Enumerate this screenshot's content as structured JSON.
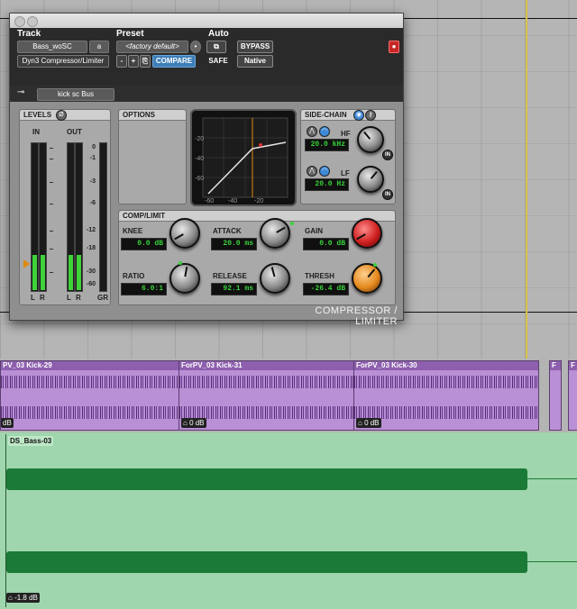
{
  "plugin": {
    "header": {
      "track_label": "Track",
      "track_name": "Bass_woSC",
      "track_variant": "a",
      "plugin_name": "Dyn3 Compressor/Limiter",
      "preset_label": "Preset",
      "preset_value": "<factory default>",
      "minus": "-",
      "plus": "+",
      "compare": "COMPARE",
      "auto_label": "Auto",
      "bypass": "BYPASS",
      "safe": "SAFE",
      "native": "Native"
    },
    "sidechain_key": "kick sc Bus",
    "levels": {
      "title": "LEVELS",
      "in_label": "IN",
      "out_label": "OUT",
      "scale": [
        "0",
        "-1",
        "-3",
        "-6",
        "-12",
        "-18",
        "-30",
        "-60"
      ],
      "l_label": "L",
      "r_label": "R",
      "gr_label": "GR",
      "in_level": 0.24,
      "out_level": 0.24
    },
    "options_title": "OPTIONS",
    "graph": {
      "y_ticks": [
        "-20",
        "-40",
        "-60"
      ],
      "x_ticks": [
        "-60",
        "-40",
        "-20"
      ]
    },
    "side_chain": {
      "title": "SIDE-CHAIN",
      "hf_label": "HF",
      "hf_value": "20.0 kHz",
      "lf_label": "LF",
      "lf_value": "20.0 Hz",
      "in_label": "IN"
    },
    "comp": {
      "title": "COMP/LIMIT",
      "knee_label": "KNEE",
      "knee_value": "0.0 dB",
      "attack_label": "ATTACK",
      "attack_value": "20.0 ms",
      "gain_label": "GAIN",
      "gain_value": "0.0 dB",
      "ratio_label": "RATIO",
      "ratio_value": "6.0:1",
      "release_label": "RELEASE",
      "release_value": "92.1 ms",
      "thresh_label": "THRESH",
      "thresh_value": "-26.4 dB"
    },
    "brand": "COMPRESSOR / LIMITER"
  },
  "tracks": {
    "kick_clips": [
      {
        "name": "PV_03 Kick-29",
        "gain": "dB"
      },
      {
        "name": "ForPV_03 Kick-31",
        "gain": "0 dB"
      },
      {
        "name": "ForPV_03 Kick-30",
        "gain": "0 dB"
      },
      {
        "name": "F",
        "gain": ""
      },
      {
        "name": "F",
        "gain": ""
      }
    ],
    "bass_clip": {
      "name": "DS_Bass-03",
      "gain": "-1.8 dB"
    }
  }
}
